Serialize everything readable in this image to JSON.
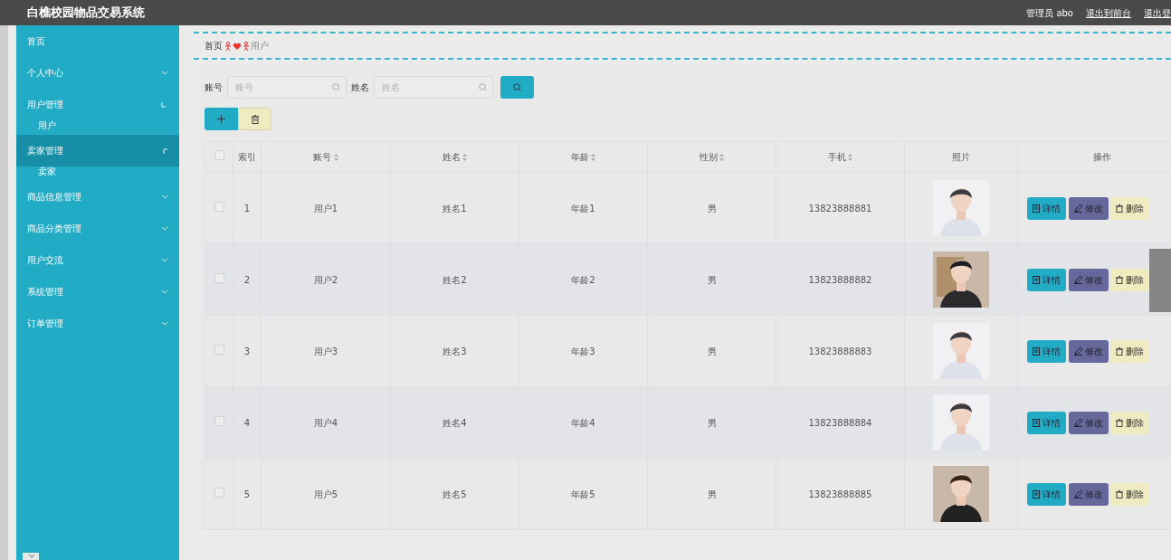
{
  "header": {
    "title": "白樵校园物品交易系统",
    "user": "管理员 abo",
    "links": [
      "退出到前台",
      "退出登"
    ]
  },
  "sidebar": {
    "items": [
      {
        "label": "首页",
        "kind": "plain",
        "hovered": false
      },
      {
        "label": "个人中心",
        "kind": "group",
        "expanded": false,
        "hovered": false
      },
      {
        "label": "用户管理",
        "kind": "group",
        "expanded": true,
        "hovered": false,
        "children": [
          {
            "label": "用户"
          }
        ]
      },
      {
        "label": "卖家管理",
        "kind": "group",
        "expanded": true,
        "hovered": true,
        "children": [
          {
            "label": "卖家"
          }
        ]
      },
      {
        "label": "商品信息管理",
        "kind": "group",
        "expanded": false,
        "hovered": false
      },
      {
        "label": "商品分类管理",
        "kind": "group",
        "expanded": false,
        "hovered": false
      },
      {
        "label": "用户交流",
        "kind": "group",
        "expanded": false,
        "hovered": false
      },
      {
        "label": "系统管理",
        "kind": "group",
        "expanded": false,
        "hovered": false
      },
      {
        "label": "订单管理",
        "kind": "group",
        "expanded": false,
        "hovered": false
      }
    ]
  },
  "breadcrumb": {
    "home": "首页",
    "current": "用户"
  },
  "search": {
    "fields": [
      {
        "label": "账号",
        "placeholder": "账号"
      },
      {
        "label": "姓名",
        "placeholder": "姓名"
      }
    ]
  },
  "table": {
    "all_checked": false,
    "columns": [
      {
        "label": "索引",
        "sortable": false
      },
      {
        "label": "账号",
        "sortable": true
      },
      {
        "label": "姓名",
        "sortable": true
      },
      {
        "label": "年龄",
        "sortable": true
      },
      {
        "label": "性别",
        "sortable": true
      },
      {
        "label": "手机",
        "sortable": true
      },
      {
        "label": "照片",
        "sortable": false
      },
      {
        "label": "操作",
        "sortable": false
      }
    ],
    "rows": [
      {
        "checked": false,
        "index": "1",
        "account": "用户1",
        "name": "姓名1",
        "age": "年龄1",
        "gender": "男",
        "phone": "13823888881",
        "actions": [
          "详情",
          "修改",
          "删除"
        ]
      },
      {
        "checked": false,
        "index": "2",
        "account": "用户2",
        "name": "姓名2",
        "age": "年龄2",
        "gender": "男",
        "phone": "13823888882",
        "actions": [
          "详情",
          "修改",
          "删除"
        ]
      },
      {
        "checked": false,
        "index": "3",
        "account": "用户3",
        "name": "姓名3",
        "age": "年龄3",
        "gender": "男",
        "phone": "13823888883",
        "actions": [
          "详情",
          "修改",
          "删除"
        ]
      },
      {
        "checked": false,
        "index": "4",
        "account": "用户4",
        "name": "姓名4",
        "age": "年龄4",
        "gender": "男",
        "phone": "13823888884",
        "actions": [
          "详情",
          "修改",
          "删除"
        ]
      },
      {
        "checked": false,
        "index": "5",
        "account": "用户5",
        "name": "姓名5",
        "age": "年龄5",
        "gender": "男",
        "phone": "13823888885",
        "actions": [
          "详情",
          "修改",
          "删除"
        ]
      }
    ]
  }
}
